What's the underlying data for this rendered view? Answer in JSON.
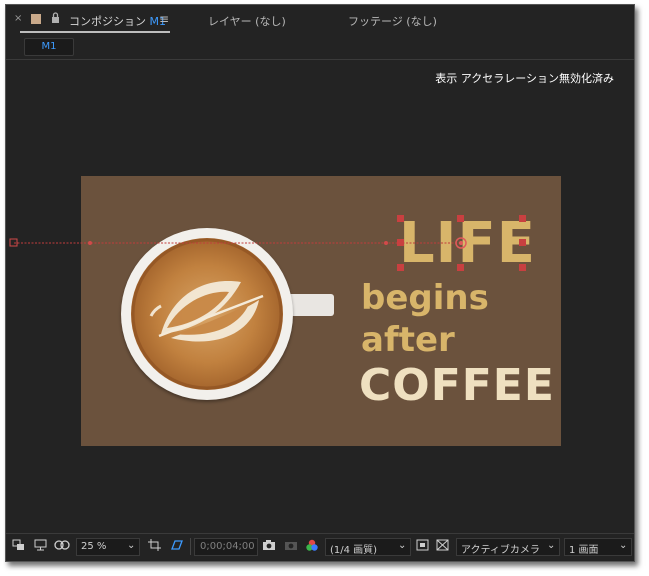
{
  "tabs": {
    "close_icon": "×",
    "lock_icon": "🔒",
    "composition_prefix": "コンポジション",
    "composition_name": "M1",
    "menu_icon": "≡",
    "layer_tab": "レイヤー (なし)",
    "footage_tab": "フッテージ (なし)"
  },
  "subtab": {
    "label": "M1"
  },
  "viewer": {
    "notice": "表示 アクセラレーション無効化済み"
  },
  "artwork": {
    "line1": "LIFE",
    "line2": "begins",
    "line3": "after",
    "line4": "COFFEE",
    "background_color": "#6b523d",
    "accent_color": "#d8b56a"
  },
  "bottombar": {
    "zoom": "25 %",
    "timecode": "0;00;04;00",
    "resolution": "(1/4 画質)",
    "camera": "アクティブカメラ",
    "views": "1 画面"
  },
  "icons": {
    "snapshot": "camera-icon",
    "color": "color-channels-icon",
    "view": "view-layout-icon"
  }
}
